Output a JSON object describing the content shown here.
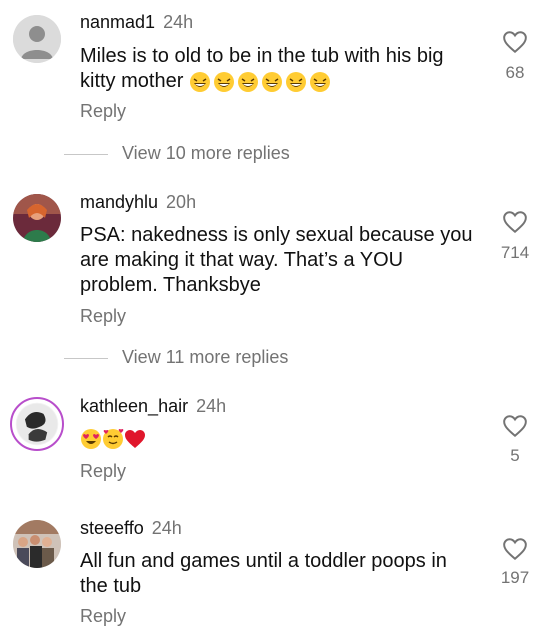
{
  "comments": [
    {
      "username": "nanmad1",
      "time": "24h",
      "text": "Miles is to old to be in the tub with his big kitty mother",
      "emoji": [
        "laughing",
        "laughing",
        "laughing",
        "laughing",
        "laughing",
        "laughing"
      ],
      "reply_label": "Reply",
      "likes": "68",
      "view_more": "View 10 more replies"
    },
    {
      "username": "mandyhlu",
      "time": "20h",
      "text": "PSA: nakedness is only sexual because you are making it that way. That’s a YOU problem. Thanksbye",
      "reply_label": "Reply",
      "likes": "714",
      "view_more": "View 11 more replies"
    },
    {
      "username": "kathleen_hair",
      "time": "24h",
      "text": "",
      "emoji": [
        "heart-eyes",
        "smiling-with-hearts",
        "red-heart"
      ],
      "reply_label": "Reply",
      "likes": "5"
    },
    {
      "username": "steeeffo",
      "time": "24h",
      "text": "All fun and games until a toddler poops in the tub",
      "reply_label": "Reply",
      "likes": "197"
    }
  ],
  "icons": {
    "like": "heart-outline-icon",
    "default_avatar": "default-avatar-icon"
  },
  "colors": {
    "text": "#111111",
    "secondary": "#737373",
    "story_ring": "#c13584"
  }
}
